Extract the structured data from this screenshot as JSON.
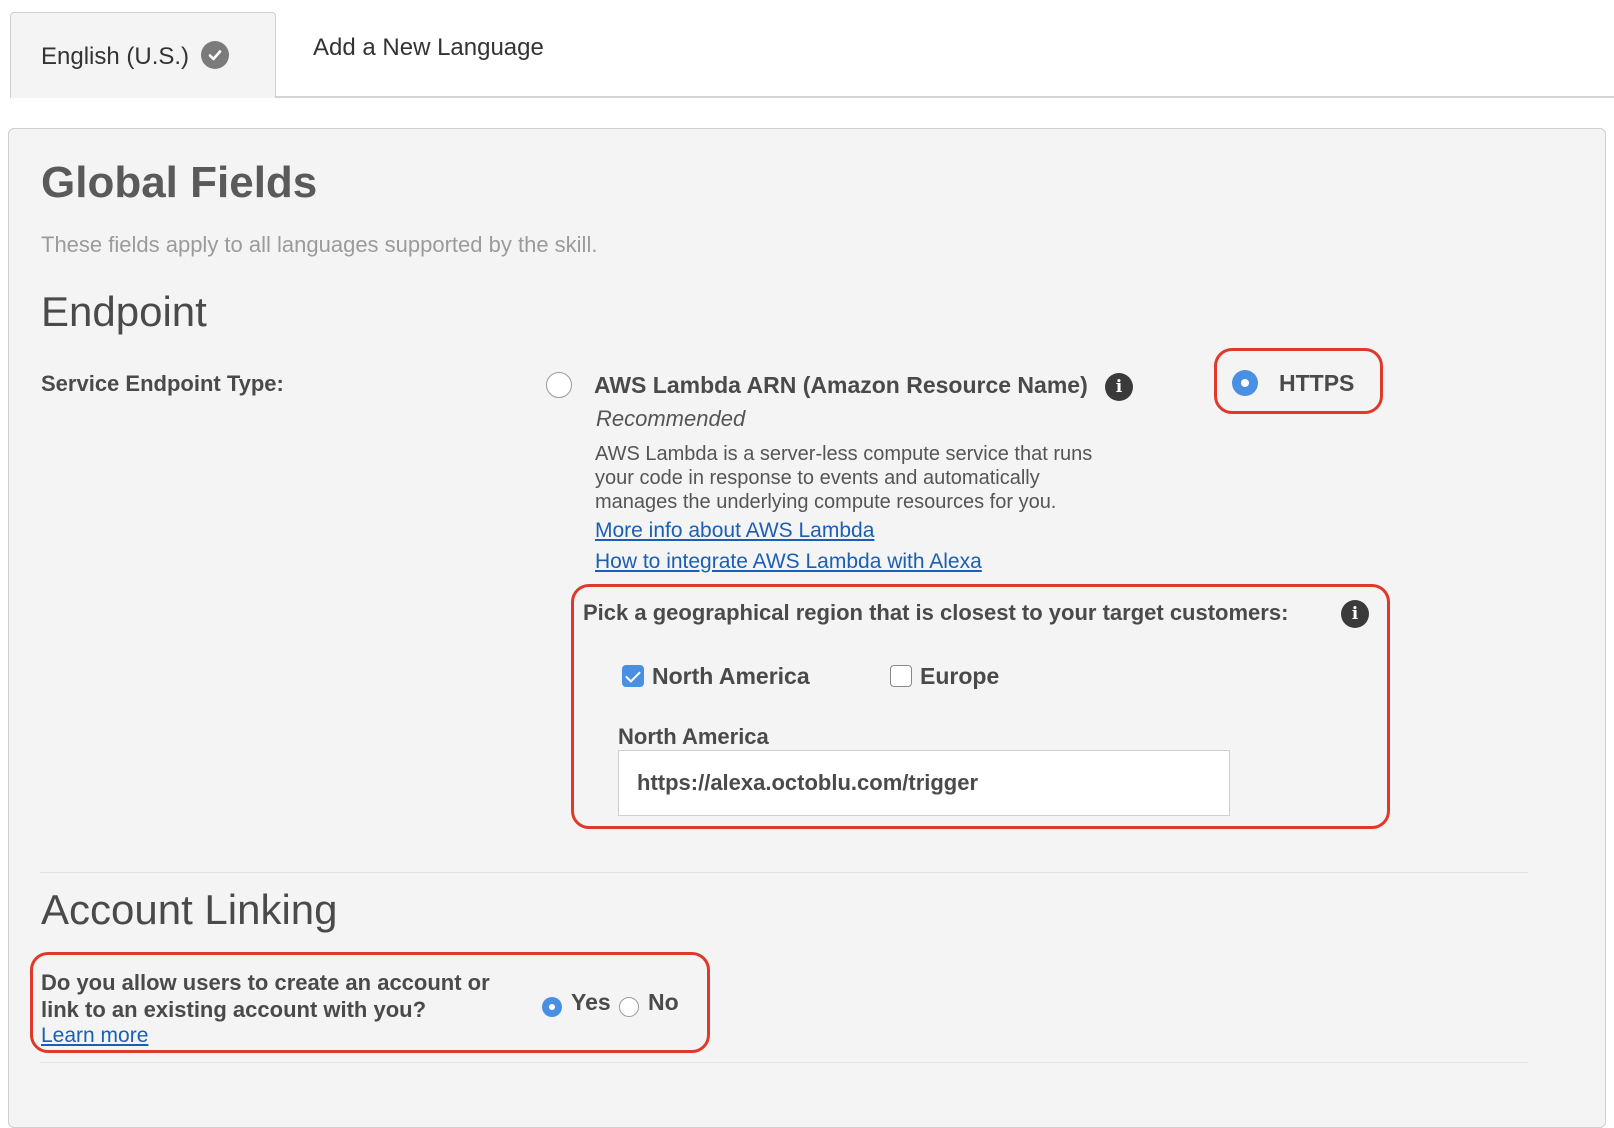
{
  "tabs": [
    {
      "label": "English (U.S.)",
      "active": true,
      "status_icon": "check-circle-icon"
    },
    {
      "label": "Add a New Language",
      "active": false
    }
  ],
  "global_fields": {
    "title": "Global Fields",
    "subtitle": "These fields apply to all languages supported by the skill."
  },
  "endpoint": {
    "heading": "Endpoint",
    "service_type_label": "Service Endpoint Type:",
    "lambda_option": {
      "label": "AWS Lambda ARN (Amazon Resource Name)",
      "recommended": "Recommended",
      "description_lines": [
        "AWS Lambda is a server-less compute service that runs",
        "your code in response to events and automatically",
        "manages the underlying compute resources for you."
      ],
      "links": [
        "More info about AWS Lambda",
        "How to integrate AWS Lambda with Alexa"
      ],
      "selected": false
    },
    "https_option": {
      "label": "HTTPS",
      "selected": true
    },
    "region": {
      "prompt": "Pick a geographical region that is closest to your target customers:",
      "options": [
        {
          "label": "North America",
          "checked": true
        },
        {
          "label": "Europe",
          "checked": false
        }
      ],
      "field_label": "North America",
      "field_value": "https://alexa.octoblu.com/trigger"
    }
  },
  "account_linking": {
    "heading": "Account Linking",
    "question_lines": [
      "Do you allow users to create an account or",
      "link to an existing account with you?"
    ],
    "learn_more": "Learn more",
    "options": [
      {
        "label": "Yes",
        "selected": true
      },
      {
        "label": "No",
        "selected": false
      }
    ]
  },
  "colors": {
    "accent_blue": "#4a90e2",
    "highlight_red": "#e0392a",
    "link_blue": "#1a5fb4"
  }
}
